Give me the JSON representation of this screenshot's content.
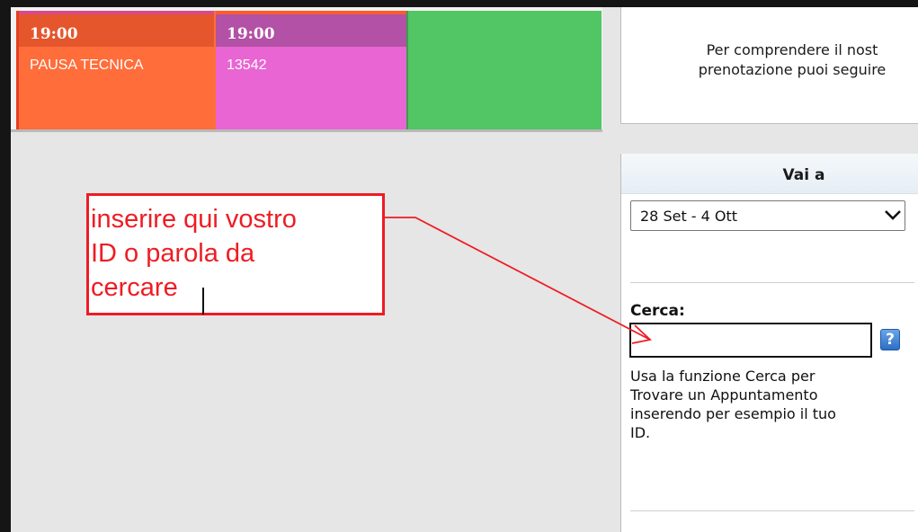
{
  "calendar": {
    "slots": [
      {
        "time": "19:00",
        "label": "PAUSA TECNICA",
        "color": "#ff6d3a"
      },
      {
        "time": "19:00",
        "label": "13542",
        "color": "#e965d3"
      },
      {
        "time": "",
        "label": "",
        "color": "#52c564"
      }
    ]
  },
  "info": {
    "text": "Per comprendere il nost\nprenotazione puoi seguire"
  },
  "vai_a": {
    "title": "Vai a",
    "selected_week": "28 Set - 4 Ott"
  },
  "search": {
    "label": "Cerca:",
    "value": "",
    "help_icon": "?",
    "help_text": "Usa la funzione Cerca per\nTrovare un Appuntamento\ninserendo per esempio il tuo\nID."
  },
  "annotation": {
    "text": "inserire qui vostro\nID o parola da\ncercare",
    "color": "#ee1c24"
  }
}
